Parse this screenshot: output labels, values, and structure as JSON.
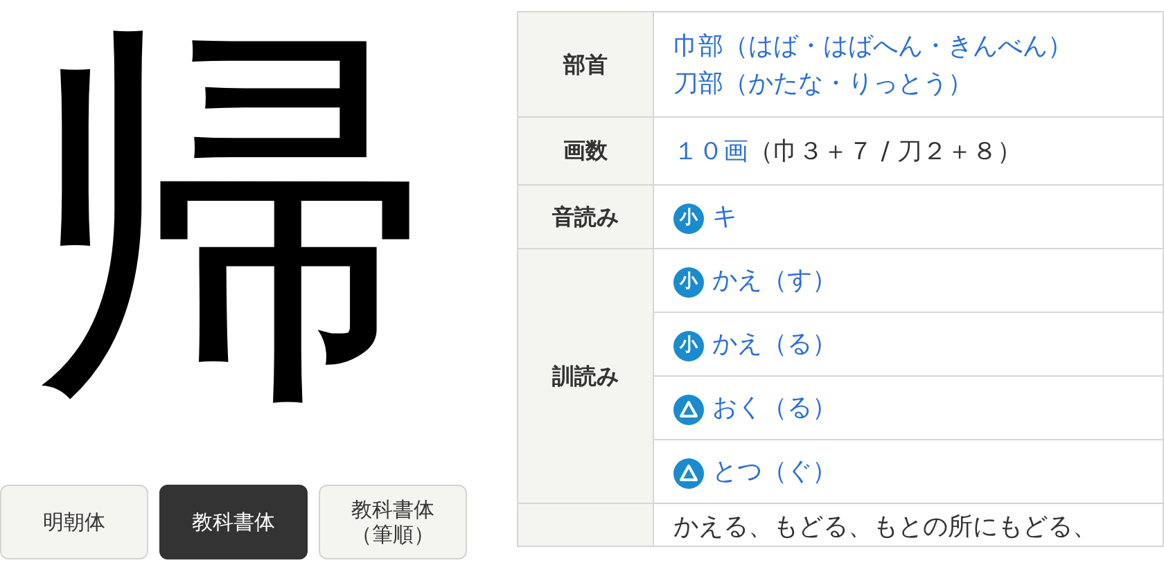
{
  "kanji": "帰",
  "font_buttons": [
    {
      "lines": [
        "明朝体"
      ],
      "selected": false
    },
    {
      "lines": [
        "教科書体"
      ],
      "selected": true
    },
    {
      "lines": [
        "教科書体",
        "（筆順）"
      ],
      "selected": false
    }
  ],
  "table": {
    "rows": [
      {
        "kind": "links",
        "header": "部首",
        "values": [
          "巾部（はば・はばへん・きんべん）",
          "刀部（かたな・りっとう）"
        ]
      },
      {
        "kind": "strokes",
        "header": "画数",
        "link": "１０画",
        "note": "（巾３＋７ / 刀２＋８）"
      },
      {
        "kind": "readings",
        "header": "音読み",
        "readings": [
          {
            "kind": "elementary",
            "badge": "小",
            "text": "キ"
          }
        ]
      },
      {
        "kind": "readings",
        "header": "訓読み",
        "readings": [
          {
            "kind": "elementary",
            "badge": "小",
            "text": "かえ（す）"
          },
          {
            "kind": "elementary",
            "badge": "小",
            "text": "かえ（る）"
          },
          {
            "kind": "outside",
            "text": "おく（る）"
          },
          {
            "kind": "outside",
            "text": "とつ（ぐ）"
          }
        ]
      },
      {
        "kind": "text",
        "header": "",
        "text": "かえる、もどる、もとの所にもどる、"
      }
    ]
  }
}
